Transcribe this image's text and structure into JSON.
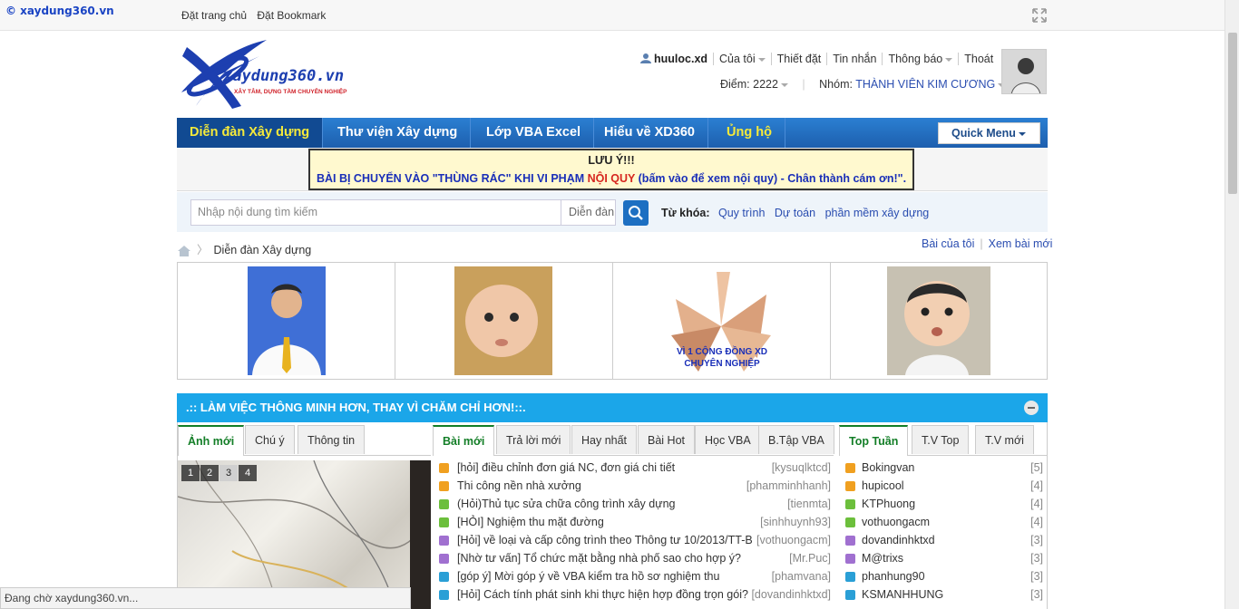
{
  "topbar": {
    "brand": "© xaydung360.vn",
    "links": [
      "Đặt trang chủ",
      "Đặt Bookmark"
    ]
  },
  "logo": {
    "text": "xaydung360.vn",
    "slogan": "XÂY TÂM, DỰNG TẦM CHUYÊN NGHIỆP"
  },
  "user": {
    "name": "huuloc.xd",
    "menu": [
      "Của tôi",
      "Thiết đặt",
      "Tin nhắn",
      "Thông báo",
      "Thoát"
    ],
    "points_label": "Điểm: 2222",
    "group_label": "Nhóm:",
    "group": "THÀNH VIÊN KIM CƯƠNG"
  },
  "nav": {
    "items": [
      "Diễn đàn Xây dựng",
      "Thư viện Xây dựng",
      "Lớp VBA Excel",
      "Hiểu về XD360",
      "Ủng hộ"
    ],
    "quick_menu": "Quick Menu"
  },
  "notice": {
    "title": "LƯU Ý!!!",
    "text_a": "BÀI BỊ CHUYỂN VÀO \"THÙNG RÁC\" KHI VI PHẠM ",
    "text_b": "NỘI QUY",
    "text_c": " (bấm vào để xem nội quy) - Chân thành cám ơn!\"."
  },
  "search": {
    "placeholder": "Nhập nội dung tìm kiếm",
    "scope": "Diễn đàn",
    "keyword_label": "Từ khóa:",
    "keywords": [
      "Quy trình",
      "Dự toán",
      "phần mềm xây dựng"
    ]
  },
  "breadcrumb": {
    "current": "Diễn đàn Xây dựng",
    "right": [
      "Bài của tôi",
      "Xem bài mới"
    ]
  },
  "banners": {
    "caption_3": "VÌ 1 CỘNG ĐỒNG XD CHUYÊN NGHIỆP"
  },
  "section": {
    "title": ".:: LÀM VIỆC THÔNG MINH HƠN, THAY VÌ CHĂM CHỈ HƠN!::.",
    "left_tabs": [
      "Ảnh mới",
      "Chú ý",
      "Thông tin"
    ],
    "pager": [
      "1",
      "2",
      "3",
      "4"
    ],
    "mid_tabs": [
      "Bài mới",
      "Trả lời mới",
      "Hay nhất",
      "Bài Hot",
      "Học VBA",
      "B.Tập VBA"
    ],
    "right_tabs": [
      "Top Tuần",
      "T.V Top",
      "T.V mới"
    ],
    "posts": [
      {
        "title": "[hỏi] điều chỉnh đơn giá NC, đơn giá chi tiết",
        "user": "[kysuqlktcd]",
        "color": "#f0a020"
      },
      {
        "title": "Thi công nền nhà xưởng",
        "user": "[phamminhhanh]",
        "color": "#f0a020"
      },
      {
        "title": "(Hỏi)Thủ tục sửa chữa công trình xây dựng",
        "user": "[tienmta]",
        "color": "#6cbf3c"
      },
      {
        "title": "[HỎI] Nghiệm thu mặt đường",
        "user": "[sinhhuynh93]",
        "color": "#6cbf3c"
      },
      {
        "title": "[Hỏi] về loại và cấp công trình theo Thông tư 10/2013/TT-B",
        "user": "[vothuongacm]",
        "color": "#a070d0"
      },
      {
        "title": "[Nhờ tư vấn] Tổ chức mặt bằng nhà phố sao cho hợp ý?",
        "user": "[Mr.Puc]",
        "color": "#a070d0"
      },
      {
        "title": "[góp ý] Mời góp ý về VBA kiểm tra hồ sơ nghiệm thu",
        "user": "[phamvana]",
        "color": "#2a9fd6"
      },
      {
        "title": "[Hỏi] Cách tính phát sinh khi thực hiện hợp đồng trọn gói?",
        "user": "[dovandinhktxd]",
        "color": "#2a9fd6"
      }
    ],
    "top": [
      {
        "name": "Bokingvan",
        "count": "[5]",
        "color": "#f0a020"
      },
      {
        "name": "hupicool",
        "count": "[4]",
        "color": "#f0a020"
      },
      {
        "name": "KTPhuong",
        "count": "[4]",
        "color": "#6cbf3c"
      },
      {
        "name": "vothuongacm",
        "count": "[4]",
        "color": "#6cbf3c"
      },
      {
        "name": "dovandinhktxd",
        "count": "[3]",
        "color": "#a070d0"
      },
      {
        "name": "M@trixs",
        "count": "[3]",
        "color": "#a070d0"
      },
      {
        "name": "phanhung90",
        "count": "[3]",
        "color": "#2a9fd6"
      },
      {
        "name": "KSMANHHUNG",
        "count": "[3]",
        "color": "#2a9fd6"
      }
    ]
  },
  "status": "Đang chờ xaydung360.vn..."
}
